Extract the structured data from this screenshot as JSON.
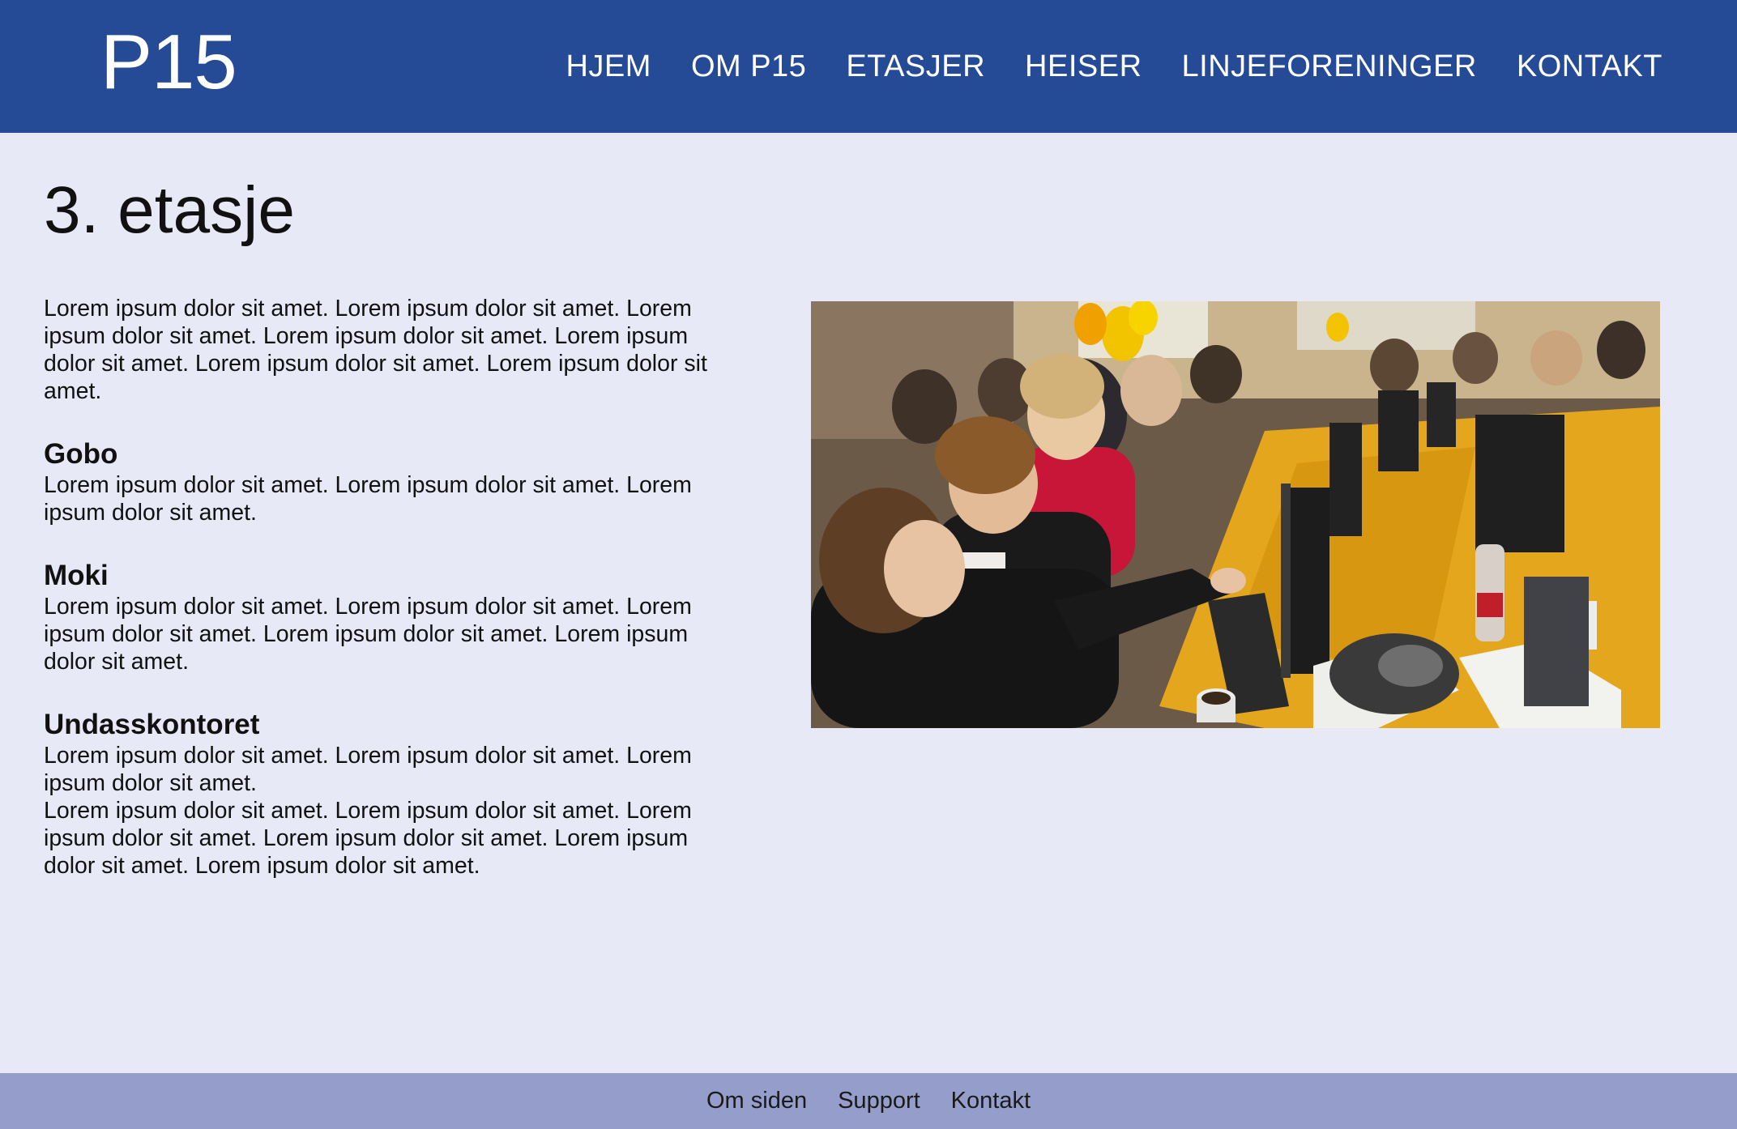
{
  "header": {
    "logo": "P15",
    "nav": [
      "HJEM",
      "OM P15",
      "ETASJER",
      "HEISER",
      "LINJEFORENINGER",
      "KONTAKT"
    ]
  },
  "main": {
    "title": "3. etasje",
    "intro": "Lorem ipsum dolor sit amet. Lorem ipsum dolor sit amet. Lorem ipsum dolor sit amet. Lorem ipsum dolor sit amet. Lorem ipsum dolor sit amet. Lorem ipsum dolor sit amet. Lorem ipsum dolor sit amet.",
    "sections": [
      {
        "heading": "Gobo",
        "text": "Lorem ipsum dolor sit amet. Lorem ipsum dolor sit amet. Lorem ipsum dolor sit amet."
      },
      {
        "heading": "Moki",
        "text": "Lorem ipsum dolor sit amet. Lorem ipsum dolor sit amet. Lorem ipsum dolor sit amet. Lorem ipsum dolor sit amet. Lorem ipsum dolor sit amet."
      },
      {
        "heading": "Undasskontoret",
        "text": "Lorem ipsum dolor sit amet. Lorem ipsum dolor sit amet. Lorem ipsum dolor sit amet.",
        "text2": "Lorem ipsum dolor sit amet. Lorem ipsum dolor sit amet. Lorem ipsum dolor sit amet. Lorem ipsum dolor sit amet. Lorem ipsum dolor sit amet. Lorem ipsum dolor sit amet."
      }
    ]
  },
  "footer": {
    "links": [
      "Om siden",
      "Support",
      "Kontakt"
    ]
  },
  "colors": {
    "header": "#264b96",
    "background": "#e7eaf6",
    "footer": "#959dca"
  }
}
